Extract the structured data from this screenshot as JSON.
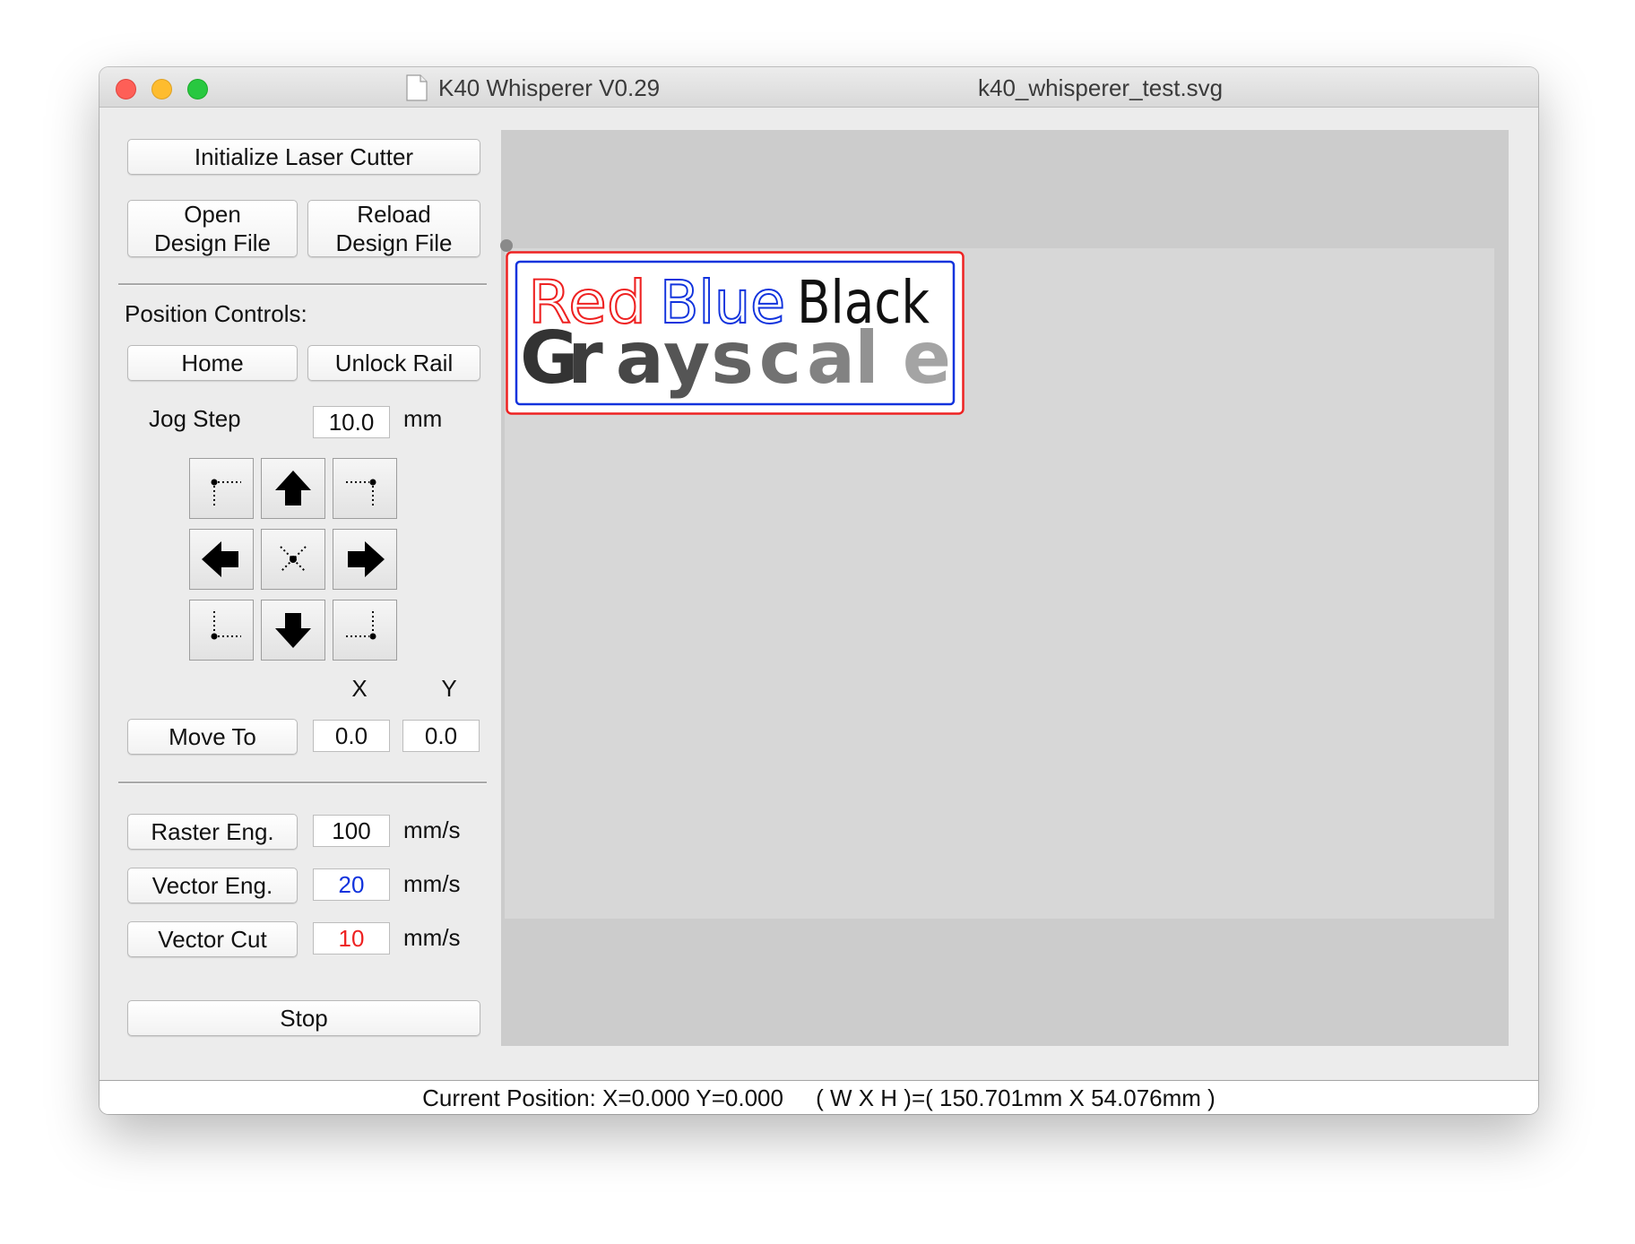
{
  "window": {
    "app_title": "K40 Whisperer V0.29",
    "file_name": "k40_whisperer_test.svg"
  },
  "controls": {
    "initialize": "Initialize Laser Cutter",
    "open_line1": "Open",
    "open_line2": "Design File",
    "reload_line1": "Reload",
    "reload_line2": "Design File",
    "position_heading": "Position Controls:",
    "home": "Home",
    "unlock_rail": "Unlock Rail",
    "jog_step_label": "Jog Step",
    "jog_step_value": "10.0",
    "jog_step_unit": "mm",
    "x_header": "X",
    "y_header": "Y",
    "move_to": "Move To",
    "move_x": "0.0",
    "move_y": "0.0",
    "raster_label": "Raster Eng.",
    "raster_speed": "100",
    "vector_eng_label": "Vector Eng.",
    "vector_eng_speed": "20",
    "vector_cut_label": "Vector Cut",
    "vector_cut_speed": "10",
    "speed_unit": "mm/s",
    "stop": "Stop"
  },
  "jog_buttons": {
    "top_left": "move-top-left-icon",
    "up": "arrow-up-icon",
    "top_right": "move-top-right-icon",
    "left": "arrow-left-icon",
    "center": "move-center-icon",
    "right": "arrow-right-icon",
    "bottom_left": "move-bottom-left-icon",
    "down": "arrow-down-icon",
    "bottom_right": "move-bottom-right-icon"
  },
  "design": {
    "word_red": "Red",
    "word_blue": "Blue",
    "word_black": "Black",
    "word_gray": "Grayscale",
    "gray_letters": [
      "G",
      "r",
      "a",
      "y",
      "s",
      "c",
      "a",
      "l",
      "e"
    ],
    "gray_shades": [
      "#333333",
      "#3d3d3d",
      "#474747",
      "#555555",
      "#636363",
      "#727272",
      "#828282",
      "#929292",
      "#a4a4a4"
    ]
  },
  "colors": {
    "red": "#ee2222",
    "blue": "#1133dd",
    "canvas_bg": "#cccccc",
    "work_area": "#d7d7d7"
  },
  "status": {
    "text": "Current Position: X=0.000 Y=0.000     ( W X H )=( 150.701mm X 54.076mm )"
  }
}
